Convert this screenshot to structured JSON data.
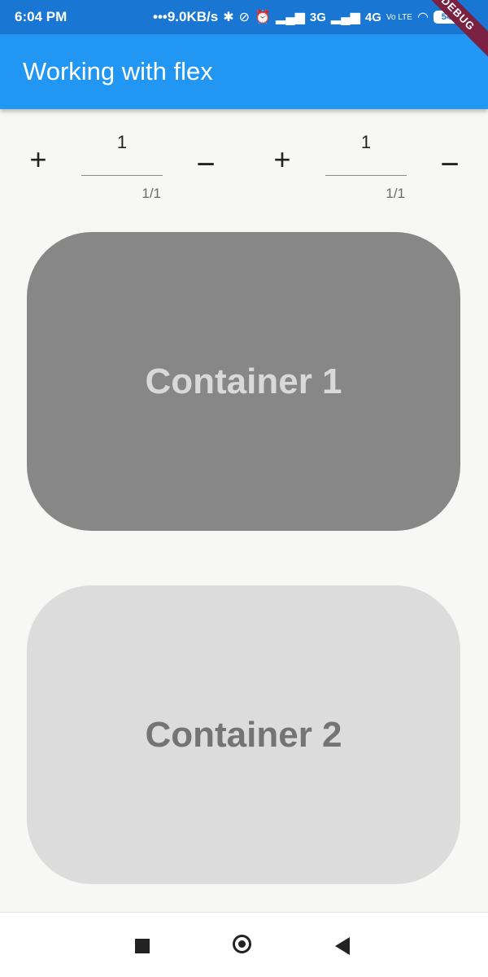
{
  "status_bar": {
    "time": "6:04 PM",
    "speed": "•••9.0KB/s",
    "icons": [
      "bluetooth-icon",
      "mute-icon",
      "alarm-icon",
      "signal-icon",
      "signal-icon",
      "wifi-icon",
      "battery-icon"
    ],
    "net_3g": "3G",
    "net_4g": "4G",
    "volte": "Vo LTE",
    "battery": "54"
  },
  "app_bar": {
    "title": "Working with flex",
    "debug_label": "DEBUG",
    "color": "#2196f3"
  },
  "controls": [
    {
      "plus": "+",
      "value": "1",
      "counter": "1/1",
      "minus": "−"
    },
    {
      "plus": "+",
      "value": "1",
      "counter": "1/1",
      "minus": "−"
    }
  ],
  "containers": [
    {
      "label": "Container 1",
      "background": "#868786",
      "text_color": "#d8d9d8"
    },
    {
      "label": "Container 2",
      "background": "#dbdcdb",
      "text_color": "#737473"
    }
  ],
  "nav_bar": {
    "icons": [
      "recents-icon",
      "home-icon",
      "back-icon"
    ]
  }
}
